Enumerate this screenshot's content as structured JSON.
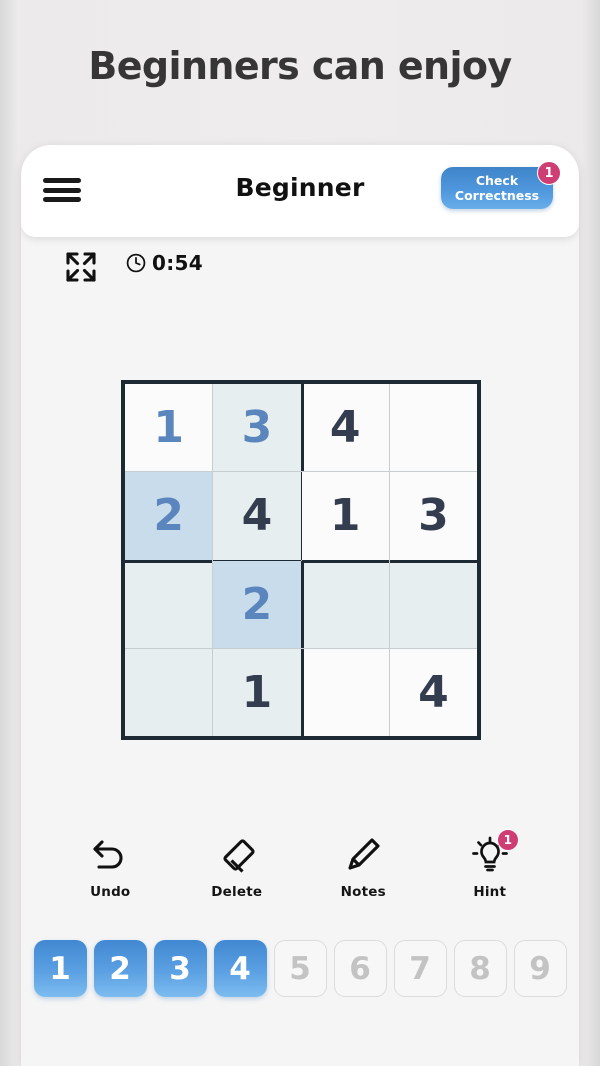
{
  "headline": "Beginners can enjoy",
  "app": {
    "header": {
      "menu_icon": "hamburger-menu-icon",
      "title": "Beginner",
      "check_button_label": "Check\nCorrectness",
      "check_button_badge": "1"
    },
    "status": {
      "fullscreen_icon": "fullscreen-expand-icon",
      "clock_icon": "clock-icon",
      "timer": "0:54"
    },
    "board": {
      "size": 4,
      "cells": [
        {
          "value": "1",
          "style": "user",
          "bg": "white"
        },
        {
          "value": "3",
          "style": "user",
          "bg": "tint"
        },
        {
          "value": "4",
          "style": "given",
          "bg": "white"
        },
        {
          "value": "",
          "style": "given",
          "bg": "white"
        },
        {
          "value": "2",
          "style": "user",
          "bg": "tint2"
        },
        {
          "value": "4",
          "style": "given",
          "bg": "tint"
        },
        {
          "value": "1",
          "style": "given",
          "bg": "white"
        },
        {
          "value": "3",
          "style": "given",
          "bg": "white"
        },
        {
          "value": "",
          "style": "given",
          "bg": "tint"
        },
        {
          "value": "2",
          "style": "user",
          "bg": "tint2"
        },
        {
          "value": "",
          "style": "given",
          "bg": "tint"
        },
        {
          "value": "",
          "style": "given",
          "bg": "tint"
        },
        {
          "value": "",
          "style": "given",
          "bg": "tint"
        },
        {
          "value": "1",
          "style": "given",
          "bg": "tint"
        },
        {
          "value": "",
          "style": "given",
          "bg": "white"
        },
        {
          "value": "4",
          "style": "given",
          "bg": "white"
        }
      ]
    },
    "tools": [
      {
        "label": "Undo",
        "icon": "undo-arrow-icon",
        "badge": ""
      },
      {
        "label": "Delete",
        "icon": "eraser-icon",
        "badge": ""
      },
      {
        "label": "Notes",
        "icon": "pencil-icon",
        "badge": ""
      },
      {
        "label": "Hint",
        "icon": "lightbulb-icon",
        "badge": "1"
      }
    ],
    "numpad": [
      {
        "label": "1",
        "state": "active"
      },
      {
        "label": "2",
        "state": "active"
      },
      {
        "label": "3",
        "state": "active"
      },
      {
        "label": "4",
        "state": "active"
      },
      {
        "label": "5",
        "state": "inactive"
      },
      {
        "label": "6",
        "state": "inactive"
      },
      {
        "label": "7",
        "state": "inactive"
      },
      {
        "label": "8",
        "state": "inactive"
      },
      {
        "label": "9",
        "state": "inactive"
      }
    ]
  },
  "colors": {
    "accent_blue": "#4f97dd",
    "badge_pink": "#cf3d75",
    "given_digit": "#333d4f",
    "user_digit": "#5b85bd",
    "cell_tint": "#e6eeef",
    "cell_selected": "#c9dcec",
    "grid_border": "#1d2a33"
  }
}
